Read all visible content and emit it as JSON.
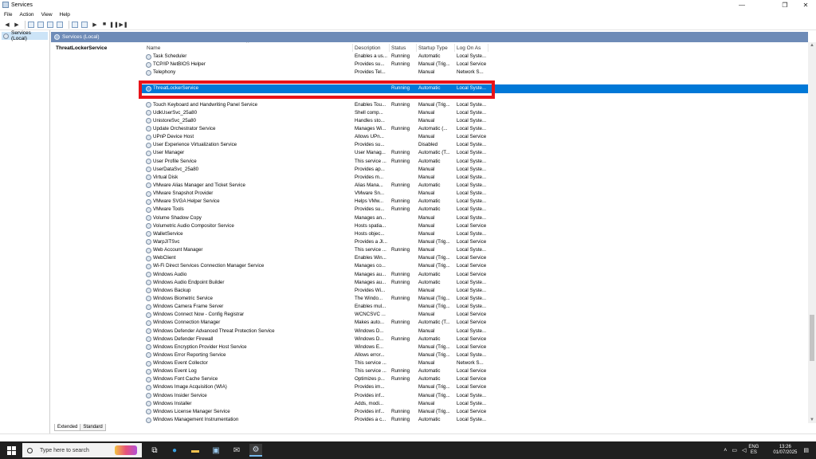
{
  "window": {
    "title": "Services",
    "controls": [
      "—",
      "❐",
      "✕"
    ]
  },
  "menu": [
    "File",
    "Action",
    "View",
    "Help"
  ],
  "sidebar": {
    "items": [
      {
        "label": "Services (Local)"
      }
    ]
  },
  "main": {
    "header": "Services (Local)",
    "selected_service_title": "ThreatLockerService"
  },
  "columns": {
    "name": "Name",
    "description": "Description",
    "status": "Status",
    "startup": "Startup Type",
    "logon": "Log On As"
  },
  "rows_top": [
    {
      "name": "Task Scheduler",
      "desc": "Enables a us...",
      "status": "Running",
      "startup": "Automatic",
      "logon": "Local Syste..."
    },
    {
      "name": "TCP/IP NetBIOS Helper",
      "desc": "Provides su...",
      "status": "Running",
      "startup": "Manual (Trig...",
      "logon": "Local Service"
    },
    {
      "name": "Telephony",
      "desc": "Provides Tel...",
      "status": "",
      "startup": "Manual",
      "logon": "Network S..."
    }
  ],
  "selected_row": {
    "name": "ThreatLockerService",
    "desc": "",
    "status": "Running",
    "startup": "Automatic",
    "logon": "Local Syste..."
  },
  "rows": [
    {
      "name": "Touch Keyboard and Handwriting Panel Service",
      "desc": "Enables Tou...",
      "status": "Running",
      "startup": "Manual (Trig...",
      "logon": "Local Syste..."
    },
    {
      "name": "UdkUserSvc_25a80",
      "desc": "Shell comp...",
      "status": "",
      "startup": "Manual",
      "logon": "Local Syste..."
    },
    {
      "name": "UnistoreSvc_25a80",
      "desc": "Handles sto...",
      "status": "",
      "startup": "Manual",
      "logon": "Local Syste..."
    },
    {
      "name": "Update Orchestrator Service",
      "desc": "Manages Wi...",
      "status": "Running",
      "startup": "Automatic (...",
      "logon": "Local Syste..."
    },
    {
      "name": "UPnP Device Host",
      "desc": "Allows UPn...",
      "status": "",
      "startup": "Manual",
      "logon": "Local Service"
    },
    {
      "name": "User Experience Virtualization Service",
      "desc": "Provides su...",
      "status": "",
      "startup": "Disabled",
      "logon": "Local Syste..."
    },
    {
      "name": "User Manager",
      "desc": "User Manag...",
      "status": "Running",
      "startup": "Automatic (T...",
      "logon": "Local Syste..."
    },
    {
      "name": "User Profile Service",
      "desc": "This service ...",
      "status": "Running",
      "startup": "Automatic",
      "logon": "Local Syste..."
    },
    {
      "name": "UserDataSvc_25a80",
      "desc": "Provides ap...",
      "status": "",
      "startup": "Manual",
      "logon": "Local Syste..."
    },
    {
      "name": "Virtual Disk",
      "desc": "Provides m...",
      "status": "",
      "startup": "Manual",
      "logon": "Local Syste..."
    },
    {
      "name": "VMware Alias Manager and Ticket Service",
      "desc": "Alias Mana...",
      "status": "Running",
      "startup": "Automatic",
      "logon": "Local Syste..."
    },
    {
      "name": "VMware Snapshot Provider",
      "desc": "VMware Sn...",
      "status": "",
      "startup": "Manual",
      "logon": "Local Syste..."
    },
    {
      "name": "VMware SVGA Helper Service",
      "desc": "Helps VMw...",
      "status": "Running",
      "startup": "Automatic",
      "logon": "Local Syste..."
    },
    {
      "name": "VMware Tools",
      "desc": "Provides su...",
      "status": "Running",
      "startup": "Automatic",
      "logon": "Local Syste..."
    },
    {
      "name": "Volume Shadow Copy",
      "desc": "Manages an...",
      "status": "",
      "startup": "Manual",
      "logon": "Local Syste..."
    },
    {
      "name": "Volumetric Audio Compositor Service",
      "desc": "Hosts spatia...",
      "status": "",
      "startup": "Manual",
      "logon": "Local Service"
    },
    {
      "name": "WalletService",
      "desc": "Hosts objec...",
      "status": "",
      "startup": "Manual",
      "logon": "Local Syste..."
    },
    {
      "name": "WarpJITSvc",
      "desc": "Provides a JI...",
      "status": "",
      "startup": "Manual (Trig...",
      "logon": "Local Service"
    },
    {
      "name": "Web Account Manager",
      "desc": "This service ...",
      "status": "Running",
      "startup": "Manual",
      "logon": "Local Syste..."
    },
    {
      "name": "WebClient",
      "desc": "Enables Win...",
      "status": "",
      "startup": "Manual (Trig...",
      "logon": "Local Service"
    },
    {
      "name": "Wi-Fi Direct Services Connection Manager Service",
      "desc": "Manages co...",
      "status": "",
      "startup": "Manual (Trig...",
      "logon": "Local Service"
    },
    {
      "name": "Windows Audio",
      "desc": "Manages au...",
      "status": "Running",
      "startup": "Automatic",
      "logon": "Local Service"
    },
    {
      "name": "Windows Audio Endpoint Builder",
      "desc": "Manages au...",
      "status": "Running",
      "startup": "Automatic",
      "logon": "Local Syste..."
    },
    {
      "name": "Windows Backup",
      "desc": "Provides Wi...",
      "status": "",
      "startup": "Manual",
      "logon": "Local Syste..."
    },
    {
      "name": "Windows Biometric Service",
      "desc": "The Windo...",
      "status": "Running",
      "startup": "Manual (Trig...",
      "logon": "Local Syste..."
    },
    {
      "name": "Windows Camera Frame Server",
      "desc": "Enables mul...",
      "status": "",
      "startup": "Manual (Trig...",
      "logon": "Local Syste..."
    },
    {
      "name": "Windows Connect Now - Config Registrar",
      "desc": "WCNCSVC ...",
      "status": "",
      "startup": "Manual",
      "logon": "Local Service"
    },
    {
      "name": "Windows Connection Manager",
      "desc": "Makes auto...",
      "status": "Running",
      "startup": "Automatic (T...",
      "logon": "Local Service"
    },
    {
      "name": "Windows Defender Advanced Threat Protection Service",
      "desc": "Windows D...",
      "status": "",
      "startup": "Manual",
      "logon": "Local Syste..."
    },
    {
      "name": "Windows Defender Firewall",
      "desc": "Windows D...",
      "status": "Running",
      "startup": "Automatic",
      "logon": "Local Service"
    },
    {
      "name": "Windows Encryption Provider Host Service",
      "desc": "Windows E...",
      "status": "",
      "startup": "Manual (Trig...",
      "logon": "Local Service"
    },
    {
      "name": "Windows Error Reporting Service",
      "desc": "Allows error...",
      "status": "",
      "startup": "Manual (Trig...",
      "logon": "Local Syste..."
    },
    {
      "name": "Windows Event Collector",
      "desc": "This service ...",
      "status": "",
      "startup": "Manual",
      "logon": "Network S..."
    },
    {
      "name": "Windows Event Log",
      "desc": "This service ...",
      "status": "Running",
      "startup": "Automatic",
      "logon": "Local Service"
    },
    {
      "name": "Windows Font Cache Service",
      "desc": "Optimizes p...",
      "status": "Running",
      "startup": "Automatic",
      "logon": "Local Service"
    },
    {
      "name": "Windows Image Acquisition (WIA)",
      "desc": "Provides im...",
      "status": "",
      "startup": "Manual (Trig...",
      "logon": "Local Service"
    },
    {
      "name": "Windows Insider Service",
      "desc": "Provides inf...",
      "status": "",
      "startup": "Manual (Trig...",
      "logon": "Local Syste..."
    },
    {
      "name": "Windows Installer",
      "desc": "Adds, modi...",
      "status": "",
      "startup": "Manual",
      "logon": "Local Syste..."
    },
    {
      "name": "Windows License Manager Service",
      "desc": "Provides inf...",
      "status": "Running",
      "startup": "Manual (Trig...",
      "logon": "Local Service"
    },
    {
      "name": "Windows Management Instrumentation",
      "desc": "Provides a c...",
      "status": "Running",
      "startup": "Automatic",
      "logon": "Local Syste..."
    }
  ],
  "tabs": [
    "Extended",
    "Standard"
  ],
  "taskbar": {
    "search_placeholder": "Type here to search",
    "lang_line1": "ENG",
    "lang_line2": "ES",
    "time": "13:26",
    "date": "01/07/2025"
  },
  "colors": {
    "header_bar": "#6e8bb7",
    "selection": "#0078d7",
    "highlight_box": "#e8131a",
    "taskbar": "#1f1f1f"
  }
}
